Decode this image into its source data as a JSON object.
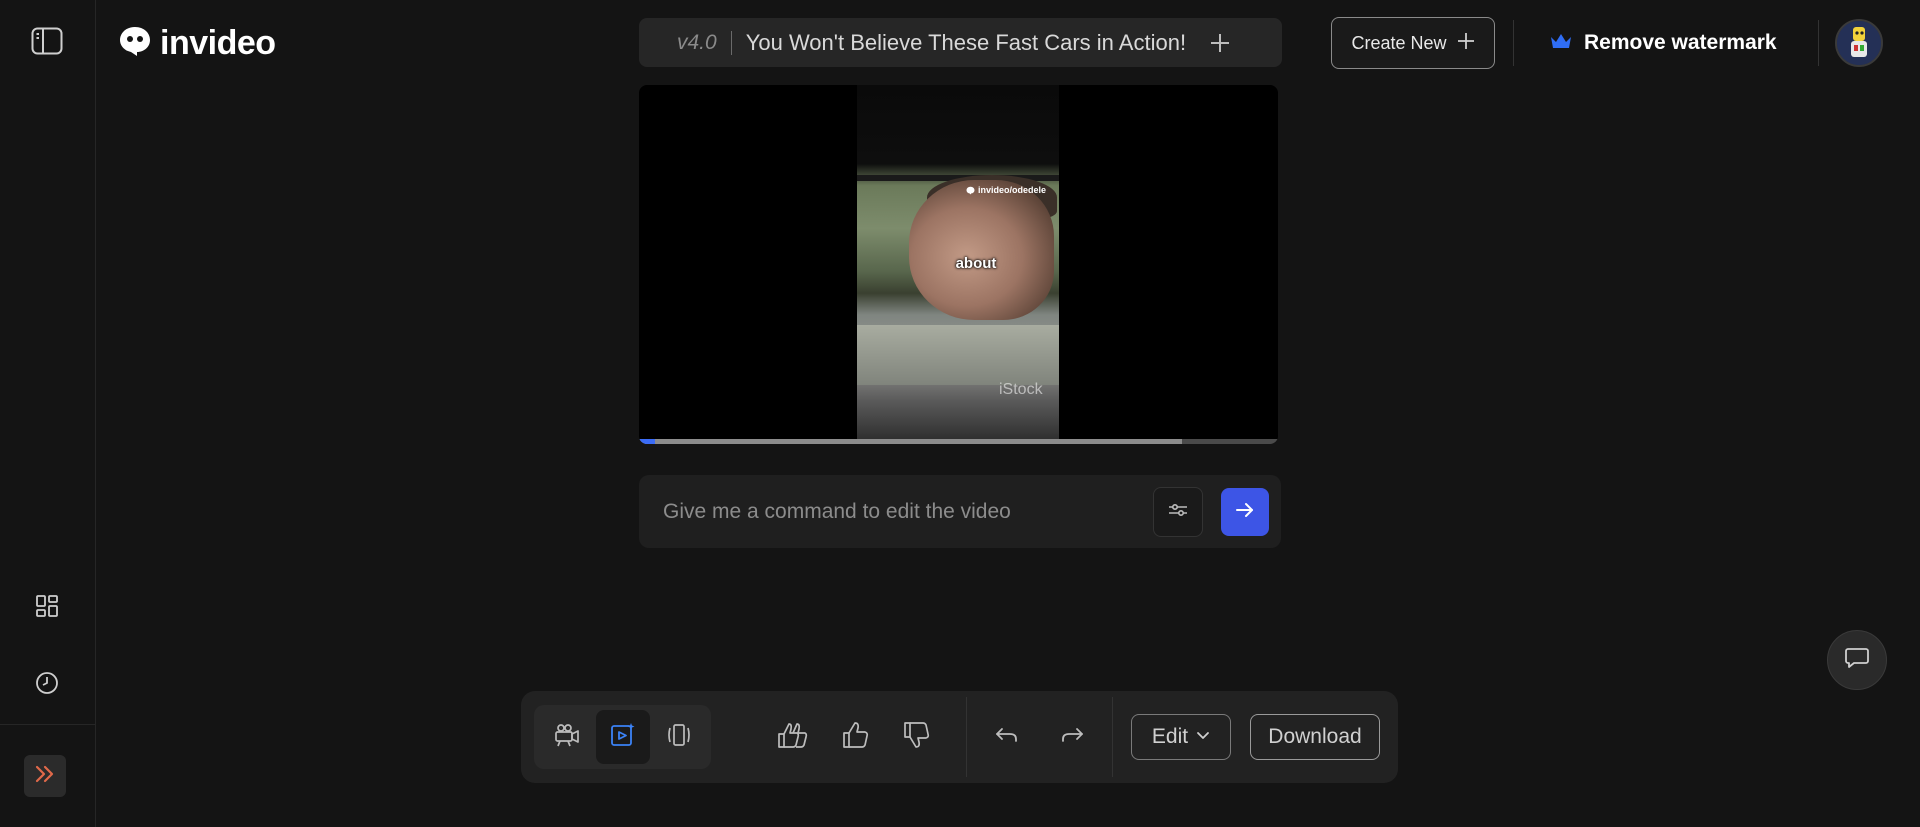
{
  "app": {
    "logo_text": "invideo"
  },
  "header": {
    "version": "v4.0",
    "project_title": "You Won't Believe These Fast Cars in Action!",
    "create_new_label": "Create New",
    "remove_watermark_label": "Remove watermark"
  },
  "video": {
    "watermark_handle": "invideo/odedele",
    "caption": "about",
    "stock_watermark": "iStock",
    "progress_fraction": 0.025,
    "buffered_fraction": 0.85
  },
  "command": {
    "placeholder": "Give me a command to edit the video",
    "value": ""
  },
  "toolbar": {
    "edit_label": "Edit",
    "download_label": "Download"
  },
  "icons": {
    "sidebar_toggle": "sidebar-toggle-icon",
    "grid": "grid-icon",
    "history": "clock-icon",
    "expand": "double-chevron-right-icon",
    "crown": "crown-icon",
    "chat": "chat-icon"
  },
  "colors": {
    "accent": "#3d55e6",
    "progress": "#3b6cf6",
    "expand_icon": "#e0694a",
    "crown": "#2f6df5"
  }
}
